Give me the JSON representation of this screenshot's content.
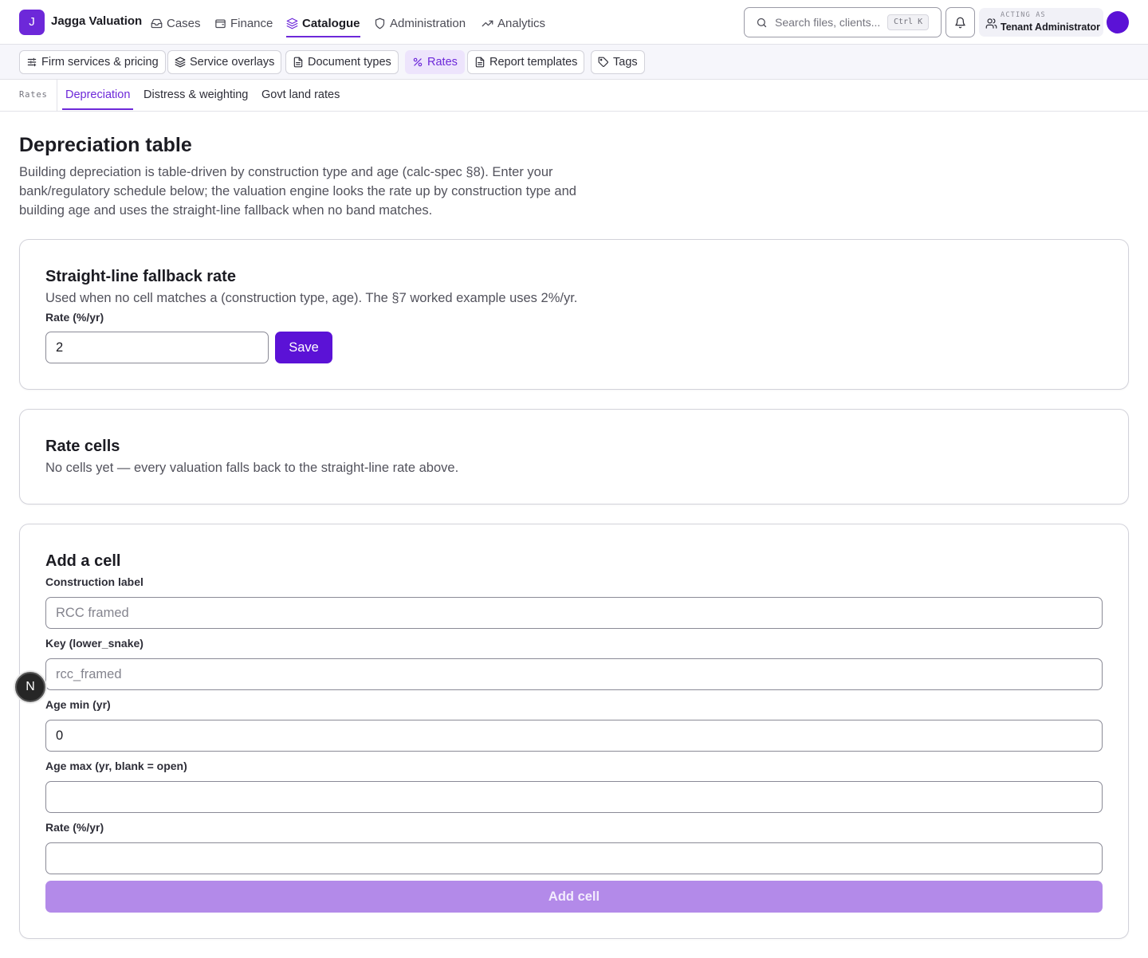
{
  "app": {
    "logo_letter": "J",
    "name": "Jagga Valuation"
  },
  "nav": {
    "cases": "Cases",
    "finance": "Finance",
    "catalogue": "Catalogue",
    "administration": "Administration",
    "analytics": "Analytics",
    "active": "Catalogue"
  },
  "search": {
    "placeholder": "Search files, clients...",
    "shortcut": "Ctrl K"
  },
  "account": {
    "caption": "ACTING AS",
    "role": "Tenant Administrator"
  },
  "subnav": {
    "firm_services": "Firm services & pricing",
    "service_overlays": "Service overlays",
    "document_types": "Document types",
    "rates": "Rates",
    "report_templates": "Report templates",
    "tags": "Tags",
    "active": "Rates"
  },
  "rates_tabs": {
    "section_label": "Rates",
    "depreciation": "Depreciation",
    "distress": "Distress & weighting",
    "govt_land": "Govt land rates",
    "active": "Depreciation"
  },
  "page": {
    "title": "Depreciation table",
    "description": "Building depreciation is table-driven by construction type and age (calc-spec §8). Enter your bank/regulatory schedule below; the valuation engine looks the rate up by construction type and building age and uses the straight-line fallback when no band matches."
  },
  "fallback": {
    "title": "Straight-line fallback rate",
    "subtitle": "Used when no cell matches a (construction type, age). The §7 worked example uses 2%/yr.",
    "rate_label": "Rate (%/yr)",
    "rate_value": "2",
    "save_label": "Save"
  },
  "rate_cells": {
    "title": "Rate cells",
    "empty_message": "No cells yet — every valuation falls back to the straight-line rate above."
  },
  "add_cell": {
    "title": "Add a cell",
    "construction_label": "Construction label",
    "construction_placeholder": "RCC framed",
    "key_label": "Key (lower_snake)",
    "key_placeholder": "rcc_framed",
    "age_min_label": "Age min (yr)",
    "age_min_value": "0",
    "age_max_label": "Age max (yr, blank = open)",
    "age_max_value": "",
    "rate_label": "Rate (%/yr)",
    "rate_value": "",
    "submit_label": "Add cell"
  },
  "dev_badge": "N",
  "colors": {
    "accent": "#6d28d9",
    "primary_button": "#5b12d6",
    "disabled_button": "#b38ae9"
  }
}
